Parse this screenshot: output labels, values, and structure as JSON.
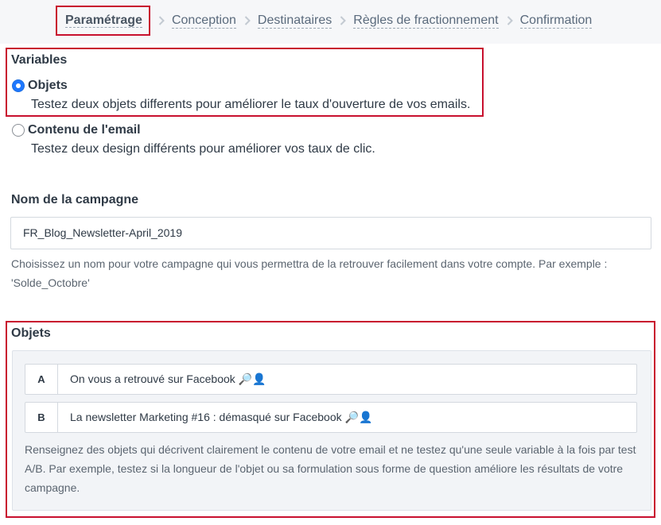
{
  "breadcrumb": {
    "steps": [
      {
        "label": "Paramétrage",
        "active": true
      },
      {
        "label": "Conception",
        "active": false
      },
      {
        "label": "Destinataires",
        "active": false
      },
      {
        "label": "Règles de fractionnement",
        "active": false
      },
      {
        "label": "Confirmation",
        "active": false
      }
    ],
    "separator_icon": "chevron-right-icon"
  },
  "variables": {
    "title": "Variables",
    "options": [
      {
        "label": "Objets",
        "description": "Testez deux objets differents pour améliorer le taux d'ouverture de vos emails.",
        "checked": true
      },
      {
        "label": "Contenu de l'email",
        "description": "Testez deux design différents pour améliorer vos taux de clic.",
        "checked": false
      }
    ]
  },
  "campaign": {
    "title": "Nom de la campagne",
    "value": "FR_Blog_Newsletter-April_2019",
    "help_line1": "Choisissez un nom pour votre campagne qui vous permettra de la retrouver facilement dans votre compte. Par exemple :",
    "help_line2": "'Solde_Octobre'"
  },
  "objets": {
    "title": "Objets",
    "subjects": [
      {
        "letter": "A",
        "text": "On vous a retrouvé sur Facebook",
        "emoji": "🔎👤"
      },
      {
        "letter": "B",
        "text": "La newsletter Marketing #16 : démasqué sur Facebook",
        "emoji": "🔎👤"
      }
    ],
    "help_line1": "Renseignez des objets qui décrivent clairement le contenu de votre email et ne testez qu'une seule variable à la fois par test",
    "help_line2": "A/B. Par exemple, testez si la longueur de l'objet ou sa formulation sous forme de question améliore les résultats de votre",
    "help_line3": "campagne."
  },
  "colors": {
    "highlight_border": "#c8102e",
    "radio_accent": "#1e78ff",
    "panel_bg": "#f2f4f7"
  }
}
